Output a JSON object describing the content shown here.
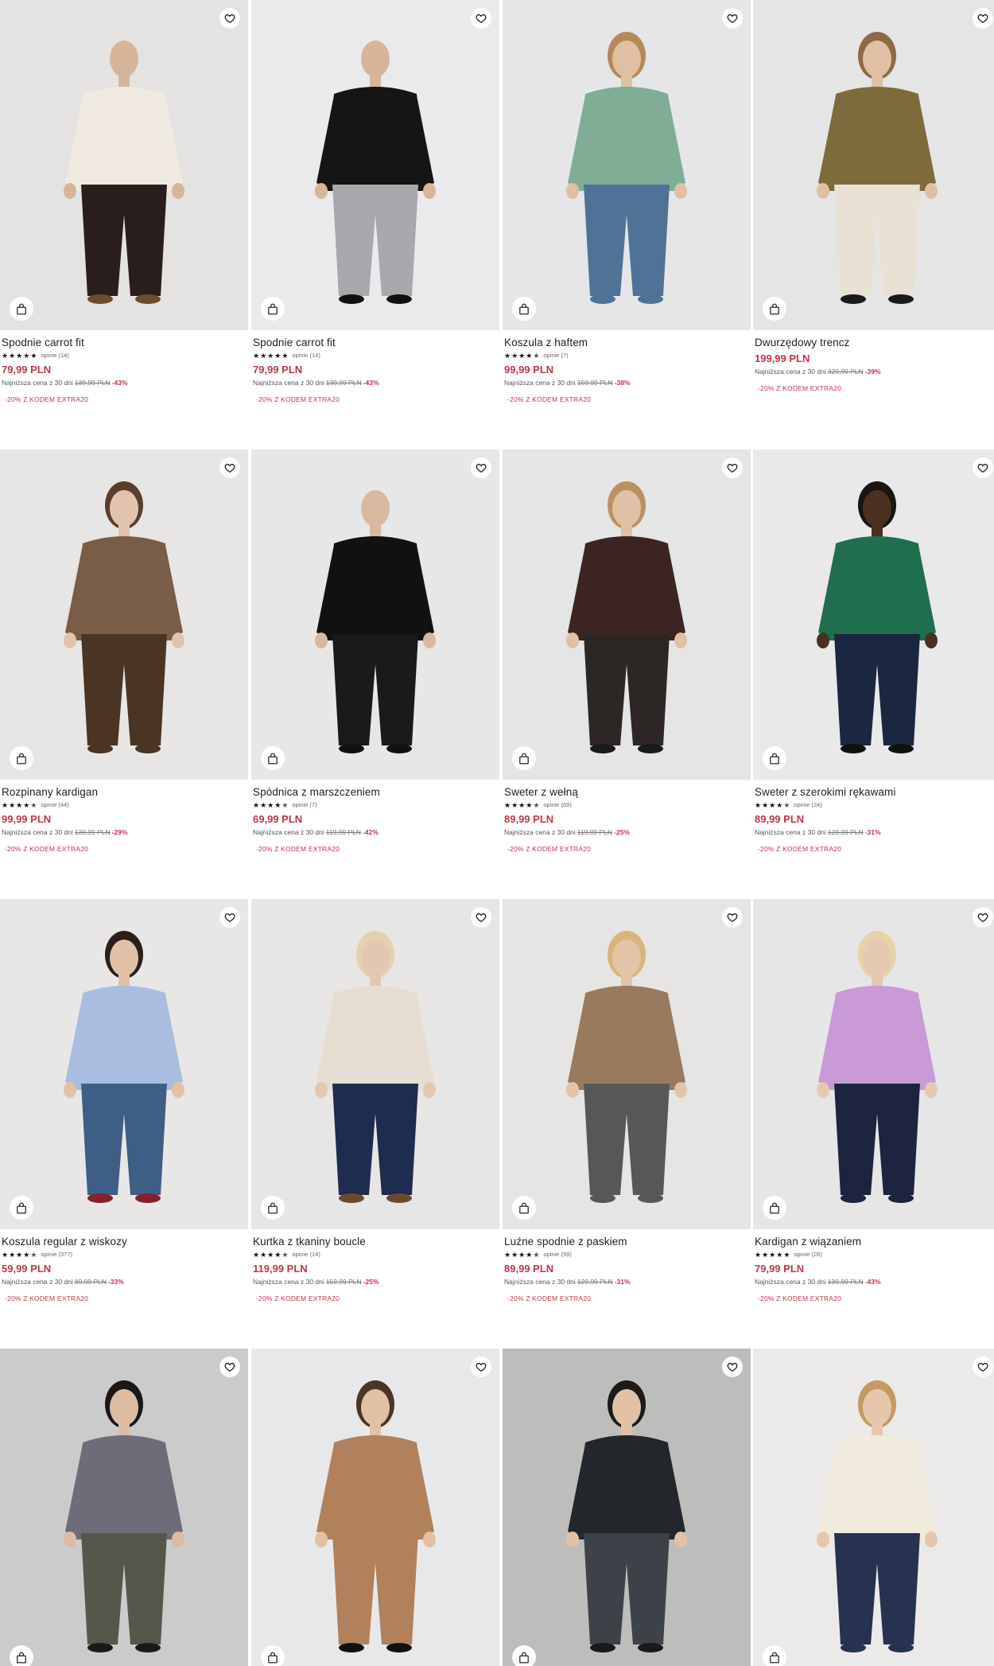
{
  "colors": {
    "sale": "#c1344b",
    "text": "#222222",
    "muted": "#666666"
  },
  "products": [
    {
      "title": "Spodnie carrot fit",
      "stars": 5,
      "reviews": "opinie (14)",
      "price": "79,99 PLN",
      "lowest_label": "Najniższa cena z 30 dni",
      "old_price": "139,99 PLN",
      "discount": "-43%",
      "promo": "-20% Z KODEM EXTRA20",
      "bg": "#e4e3e1",
      "figure": {
        "top": "#efe9e1",
        "bottom": "#2a1e1c",
        "skin": "#d7b59a",
        "hair": "#e4e3e1",
        "shoes": "#6a4d2c"
      }
    },
    {
      "title": "Spodnie carrot fit",
      "stars": 5,
      "reviews": "opinie (14)",
      "price": "79,99 PLN",
      "lowest_label": "Najniższa cena z 30 dni",
      "old_price": "139,99 PLN",
      "discount": "-43%",
      "promo": "-20% Z KODEM EXTRA20",
      "bg": "#eaeaec",
      "figure": {
        "top": "#151515",
        "bottom": "#a9a9ad",
        "skin": "#d7b59a",
        "hair": "#eaeaec",
        "shoes": "#111111"
      }
    },
    {
      "title": "Koszula z haftem",
      "stars": 4.5,
      "reviews": "opinie (7)",
      "price": "99,99 PLN",
      "lowest_label": "Najniższa cena z 30 dni",
      "old_price": "159,99 PLN",
      "discount": "-38%",
      "promo": "-20% Z KODEM EXTRA20",
      "bg": "#e6e6e8",
      "figure": {
        "top": "#80ad95",
        "bottom": "#4f7397",
        "skin": "#e0bfa4",
        "hair": "#b48a55",
        "shoes": "#4f7397"
      }
    },
    {
      "title": "Dwurzędowy trencz",
      "stars": 0,
      "reviews": "",
      "price": "199,99 PLN",
      "lowest_label": "Najniższa cena z 30 dni",
      "old_price": "329,99 PLN",
      "discount": "-39%",
      "promo": "-20% Z KODEM EXTRA20",
      "bg": "#e6e5e6",
      "figure": {
        "top": "#7e6b3c",
        "bottom": "#e9e2d4",
        "skin": "#dfc0a5",
        "hair": "#8d6a45",
        "shoes": "#1a1a1a"
      }
    },
    {
      "title": "Rozpinany kardigan",
      "stars": 4.5,
      "reviews": "opinie (44)",
      "price": "99,99 PLN",
      "lowest_label": "Najniższa cena z 30 dni",
      "old_price": "139,99 PLN",
      "discount": "-29%",
      "promo": "-20% Z KODEM EXTRA20",
      "bg": "#e8e6e5",
      "figure": {
        "top": "#7a5d47",
        "bottom": "#4a3524",
        "skin": "#e2c3ad",
        "hair": "#5a3e2b",
        "shoes": "#4a3524"
      }
    },
    {
      "title": "Spódnica z marszczeniem",
      "stars": 4.5,
      "reviews": "opinie (7)",
      "price": "69,99 PLN",
      "lowest_label": "Najniższa cena z 30 dni",
      "old_price": "119,99 PLN",
      "discount": "-42%",
      "promo": "-20% Z KODEM EXTRA20",
      "bg": "#e7e7e8",
      "figure": {
        "top": "#111111",
        "bottom": "#1a1a1a",
        "skin": "#d9b8a0",
        "hair": "#e7e7e8",
        "shoes": "#111111"
      }
    },
    {
      "title": "Sweter z wełną",
      "stars": 4.5,
      "reviews": "opinie (69)",
      "price": "89,99 PLN",
      "lowest_label": "Najniższa cena z 30 dni",
      "old_price": "119,99 PLN",
      "discount": "-25%",
      "promo": "-20% Z KODEM EXTRA20",
      "bg": "#e5e5e6",
      "figure": {
        "top": "#3b2422",
        "bottom": "#2c2625",
        "skin": "#e0c0a6",
        "hair": "#b9925f",
        "shoes": "#1a1a1a"
      }
    },
    {
      "title": "Sweter z szerokimi rękawami",
      "stars": 4.5,
      "reviews": "opinie (24)",
      "price": "89,99 PLN",
      "lowest_label": "Najniższa cena z 30 dni",
      "old_price": "129,99 PLN",
      "discount": "-31%",
      "promo": "-20% Z KODEM EXTRA20",
      "bg": "#e9e9ea",
      "figure": {
        "top": "#1f6f4f",
        "bottom": "#1b2740",
        "skin": "#4b3022",
        "hair": "#1a1412",
        "shoes": "#111111"
      }
    },
    {
      "title": "Koszula regular z wiskozy",
      "stars": 4.5,
      "reviews": "opinie (377)",
      "price": "59,99 PLN",
      "lowest_label": "Najniższa cena z 30 dni",
      "old_price": "89,99 PLN",
      "discount": "-33%",
      "promo": "-20% Z KODEM EXTRA20",
      "bg": "#e9e7e5",
      "figure": {
        "top": "#a9bde0",
        "bottom": "#3f5e86",
        "skin": "#e2c1a7",
        "hair": "#2a1f1a",
        "shoes": "#8a1f26"
      }
    },
    {
      "title": "Kurtka z tkaniny boucle",
      "stars": 4.5,
      "reviews": "opinie (14)",
      "price": "119,99 PLN",
      "lowest_label": "Najniższa cena z 30 dni",
      "old_price": "159,99 PLN",
      "discount": "-25%",
      "promo": "-20% Z KODEM EXTRA20",
      "bg": "#e7e6e4",
      "figure": {
        "top": "#e5ded0",
        "bottom": "#1d2c4f",
        "skin": "#e4c7b0",
        "hair": "#e3d2b2",
        "shoes": "#6a4a2b"
      }
    },
    {
      "title": "Luźne spodnie z paskiem",
      "stars": 4.5,
      "reviews": "opinie (59)",
      "price": "89,99 PLN",
      "lowest_label": "Najniższa cena z 30 dni",
      "old_price": "129,99 PLN",
      "discount": "-31%",
      "promo": "-20% Z KODEM EXTRA20",
      "bg": "#e6e5e4",
      "figure": {
        "top": "#9a7a5e",
        "bottom": "#565759",
        "skin": "#e3c4aa",
        "hair": "#d8b57a",
        "shoes": "#565759"
      }
    },
    {
      "title": "Kardigan z wiązaniem",
      "stars": 5,
      "reviews": "opinie (26)",
      "price": "79,99 PLN",
      "lowest_label": "Najniższa cena z 30 dni",
      "old_price": "139,99 PLN",
      "discount": "-43%",
      "promo": "-20% Z KODEM EXTRA20",
      "bg": "#e6e6e7",
      "figure": {
        "top": "#c99ad6",
        "bottom": "#1c2440",
        "skin": "#e6c9b2",
        "hair": "#e6d4a8",
        "shoes": "#1c2440"
      }
    },
    {
      "title": "",
      "stars": 0,
      "reviews": "",
      "price": "",
      "lowest_label": "",
      "old_price": "",
      "discount": "",
      "promo": "",
      "bg": "#cbcbcb",
      "figure": {
        "top": "#6c6d79",
        "bottom": "#55574a",
        "skin": "#dcbda4",
        "hair": "#1b1716",
        "shoes": "#1a1a1a"
      }
    },
    {
      "title": "",
      "stars": 0,
      "reviews": "",
      "price": "",
      "lowest_label": "",
      "old_price": "",
      "discount": "",
      "promo": "",
      "bg": "#e8e8ea",
      "figure": {
        "top": "#b0815a",
        "bottom": "#b0815a",
        "skin": "#e0c1a6",
        "hair": "#4a3526",
        "shoes": "#111111"
      }
    },
    {
      "title": "",
      "stars": 0,
      "reviews": "",
      "price": "",
      "lowest_label": "",
      "old_price": "",
      "discount": "",
      "promo": "",
      "bg": "#bdbdbc",
      "figure": {
        "top": "#23262a",
        "bottom": "#3d4148",
        "skin": "#e1c2a6",
        "hair": "#1d1a18",
        "shoes": "#1a1a1a"
      }
    },
    {
      "title": "",
      "stars": 0,
      "reviews": "",
      "price": "",
      "lowest_label": "",
      "old_price": "",
      "discount": "",
      "promo": "",
      "bg": "#eceae8",
      "figure": {
        "top": "#f1ebdd",
        "bottom": "#26324f",
        "skin": "#e6c7ad",
        "hair": "#c49a62",
        "shoes": "#26324f"
      }
    }
  ]
}
